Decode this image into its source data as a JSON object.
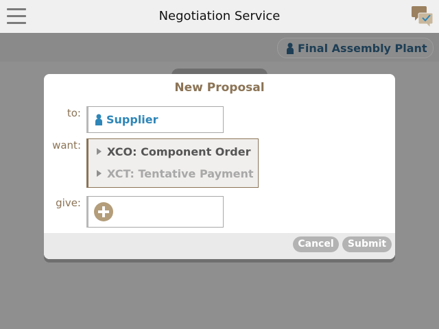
{
  "header": {
    "title": "Negotiation Service",
    "menu_icon": "hamburger-menu-icon",
    "chat_icon": "chat-bubbles-icon"
  },
  "subbar": {
    "organization": "Final Assembly Plant",
    "organization_icon": "person-icon"
  },
  "modal": {
    "title": "New Proposal",
    "to_label": "to:",
    "to_value": "Supplier",
    "want_label": "want:",
    "want_items": [
      {
        "label": "XCO: Component Order",
        "state": "active"
      },
      {
        "label": "XCT: Tentative Payment",
        "state": "disabled"
      }
    ],
    "give_label": "give:",
    "give_add_icon": "add-circle-icon",
    "cancel_label": "Cancel",
    "submit_label": "Submit"
  },
  "colors": {
    "accent": "#8b7355",
    "link_blue": "#2e86b8",
    "header_bg": "#f0f0f0",
    "overlay": "#8f8f8f"
  }
}
